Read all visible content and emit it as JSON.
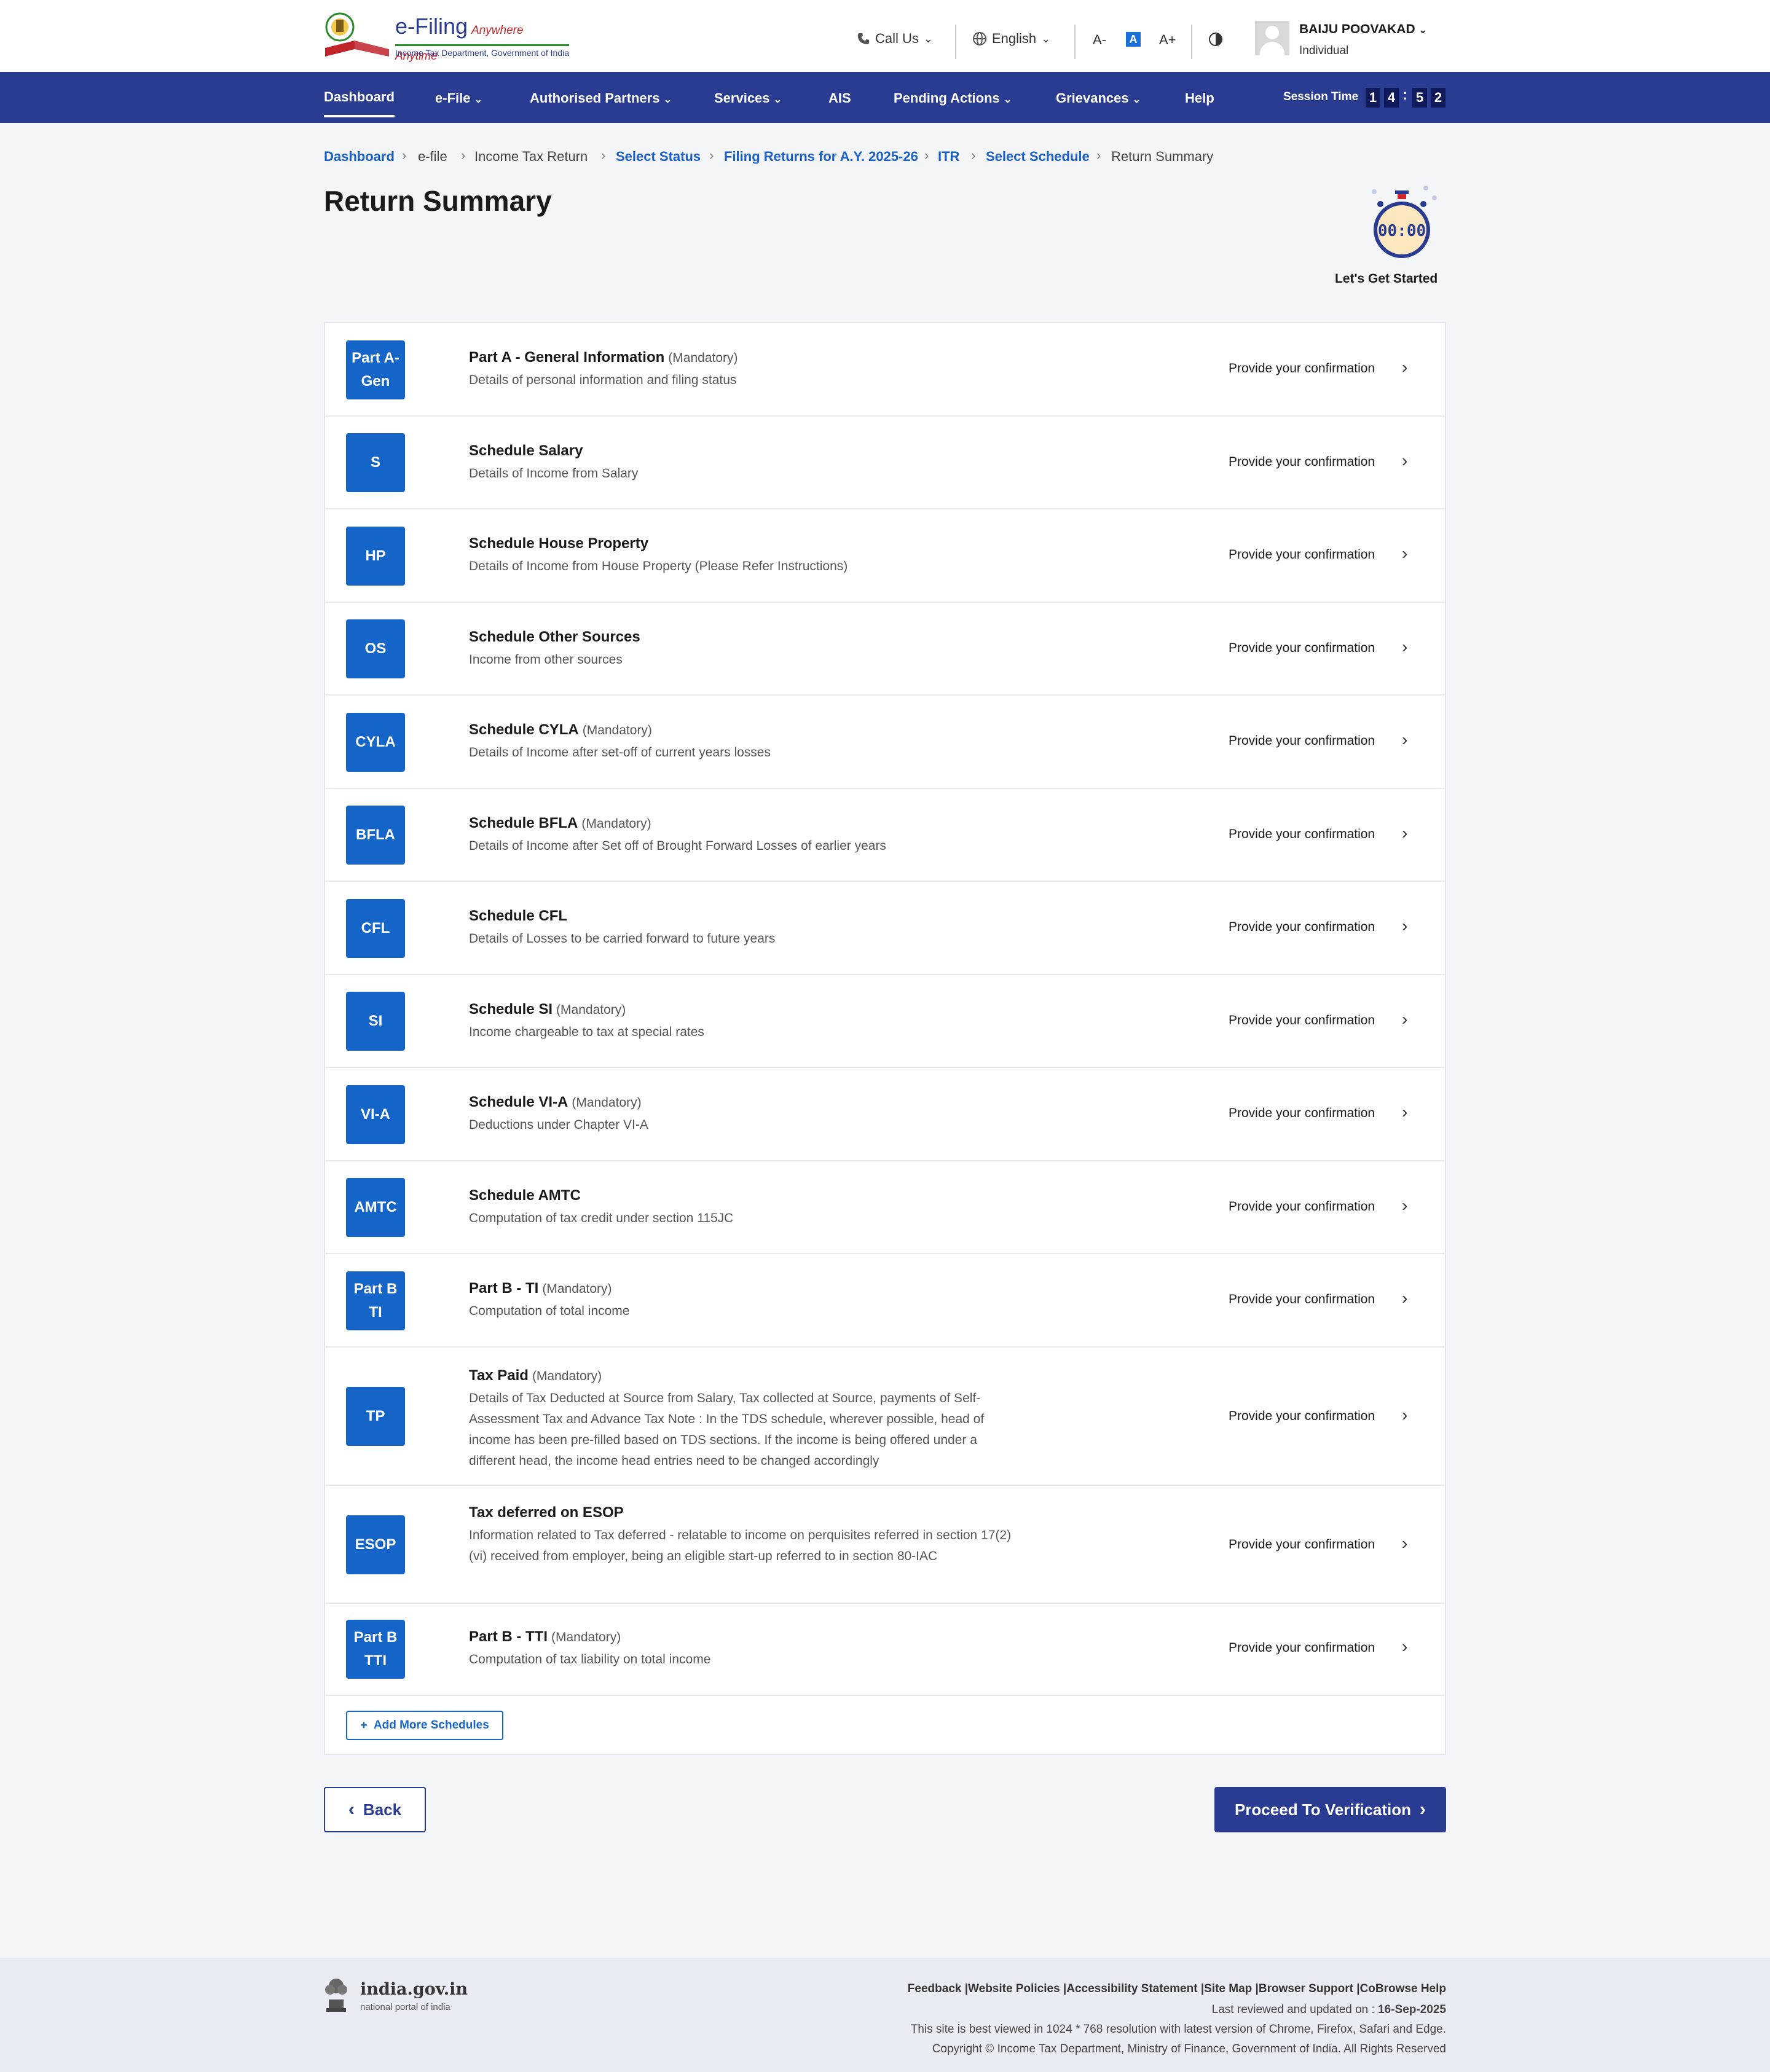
{
  "header": {
    "logo_title": "e-Filing",
    "logo_tagline": "Anywhere Anytime",
    "logo_dept": "Income Tax Department, Government of India",
    "call_us": "Call Us",
    "language": "English",
    "font_decrease": "A-",
    "font_normal": "A",
    "font_increase": "A+",
    "user_name": "BAIJU POOVAKAD",
    "user_role": "Individual"
  },
  "nav": {
    "items": [
      {
        "label": "Dashboard"
      },
      {
        "label": "e-File"
      },
      {
        "label": "Authorised Partners"
      },
      {
        "label": "Services"
      },
      {
        "label": "AIS"
      },
      {
        "label": "Pending Actions"
      },
      {
        "label": "Grievances"
      },
      {
        "label": "Help"
      }
    ],
    "session_label": "Session Time",
    "session_digits": [
      "1",
      "4",
      "5",
      "2"
    ]
  },
  "breadcrumb": [
    {
      "label": "Dashboard"
    },
    {
      "label": "e-file"
    },
    {
      "label": "Income Tax Return"
    },
    {
      "label": "Select Status"
    },
    {
      "label": "Filing Returns for A.Y. 2025-26"
    },
    {
      "label": "ITR"
    },
    {
      "label": "Select Schedule"
    },
    {
      "label": "Return Summary"
    }
  ],
  "page": {
    "title": "Return Summary",
    "timer_display": "00:00",
    "timer_label": "Let's Get Started"
  },
  "schedules": [
    {
      "badge": "Part A-\nGen",
      "title": "Part A - General Information",
      "mandatory": "(Mandatory)",
      "desc": "Details of personal information and filing status",
      "action": "Provide your confirmation"
    },
    {
      "badge": "S",
      "title": "Schedule Salary",
      "mandatory": "",
      "desc": "Details of Income from Salary",
      "action": "Provide your confirmation"
    },
    {
      "badge": "HP",
      "title": "Schedule House Property",
      "mandatory": "",
      "desc": "Details of Income from House Property (Please Refer Instructions)",
      "action": "Provide your confirmation"
    },
    {
      "badge": "OS",
      "title": "Schedule Other Sources",
      "mandatory": "",
      "desc": "Income from other sources",
      "action": "Provide your confirmation"
    },
    {
      "badge": "CYLA",
      "title": "Schedule CYLA",
      "mandatory": "(Mandatory)",
      "desc": "Details of Income after set-off of current years losses",
      "action": "Provide your confirmation"
    },
    {
      "badge": "BFLA",
      "title": "Schedule BFLA",
      "mandatory": "(Mandatory)",
      "desc": "Details of Income after Set off of Brought Forward Losses of earlier years",
      "action": "Provide your confirmation"
    },
    {
      "badge": "CFL",
      "title": "Schedule CFL",
      "mandatory": "",
      "desc": "Details of Losses to be carried forward to future years",
      "action": "Provide your confirmation"
    },
    {
      "badge": "SI",
      "title": "Schedule SI",
      "mandatory": "(Mandatory)",
      "desc": "Income chargeable to tax at special rates",
      "action": "Provide your confirmation"
    },
    {
      "badge": "VI-A",
      "title": "Schedule VI-A",
      "mandatory": "(Mandatory)",
      "desc": "Deductions under Chapter VI-A",
      "action": "Provide your confirmation"
    },
    {
      "badge": "AMTC",
      "title": "Schedule AMTC",
      "mandatory": "",
      "desc": "Computation of tax credit under section 115JC",
      "action": "Provide your confirmation"
    },
    {
      "badge": "Part B\nTI",
      "title": "Part B - TI",
      "mandatory": "(Mandatory)",
      "desc": "Computation of total income",
      "action": "Provide your confirmation"
    },
    {
      "badge": "TP",
      "title": "Tax Paid",
      "mandatory": "(Mandatory)",
      "desc": "Details of Tax Deducted at Source from Salary, Tax collected at Source, payments of Self-Assessment Tax and Advance Tax Note : In the TDS schedule, wherever possible, head of income has been pre-filled based on TDS sections. If the income is being offered under a different head, the income head entries need to be changed accordingly",
      "action": "Provide your confirmation"
    },
    {
      "badge": "ESOP",
      "title": "Tax deferred on ESOP",
      "mandatory": "",
      "desc": "Information related to Tax deferred - relatable to income on perquisites referred in section 17(2)(vi) received from employer, being an eligible start-up referred to in section 80-IAC",
      "action": "Provide your confirmation"
    },
    {
      "badge": "Part B\nTTI",
      "title": "Part B - TTI",
      "mandatory": "(Mandatory)",
      "desc": "Computation of tax liability on total income",
      "action": "Provide your confirmation"
    }
  ],
  "buttons": {
    "add_more": "Add More Schedules",
    "back": "Back",
    "proceed": "Proceed To Verification"
  },
  "footer": {
    "portal_name": "india.gov.in",
    "portal_sub": "national portal of india",
    "links": "Feedback |Website Policies |Accessibility Statement |Site Map |Browser Support |CoBrowse Help",
    "last_reviewed_label": "Last reviewed and updated on : ",
    "last_reviewed_date": "16-Sep-2025",
    "best_viewed": "This site is best viewed in 1024 * 768 resolution with latest version of Chrome, Firefox, Safari and Edge.",
    "copyright": "Copyright © Income Tax Department, Ministry of Finance, Government of India. All Rights Reserved"
  },
  "colors": {
    "brand_navy": "#2a3c92",
    "badge_blue": "#1565c9",
    "link_blue": "#1b60c6"
  }
}
